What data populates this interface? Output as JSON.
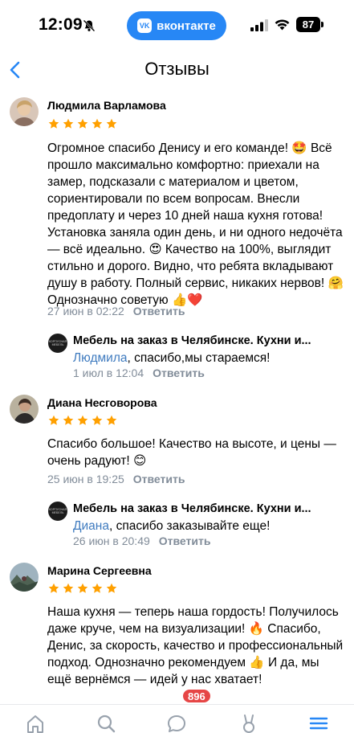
{
  "status_bar": {
    "time": "12:09",
    "app_name": "вконтакте",
    "battery": "87",
    "accent_color": "#2787f5"
  },
  "header": {
    "title": "Отзывы"
  },
  "reviews": [
    {
      "author": "Людмила Варламова",
      "rating": 5,
      "text": "Огромное спасибо Денису и его команде! 🤩 Всё прошло максимально комфортно: приехали на замер, подсказали с материалом и цветом, сориентировали по всем вопросам. Внесли предоплату и через 10 дней наша кухня готова! Установка заняла один день, и ни одного недочёта — всё идеально. 😍 Качество на 100%, выглядит стильно и дорого. Видно, что ребята вкладывают душу в работу. Полный сервис, никаких нервов! 🤗 Однозначно советую 👍❤️",
      "date": "27 июн в 02:22",
      "reply_label": "Ответить",
      "response": {
        "org_name": "Мебель на заказ в Челябинске. Кухни и...",
        "mention": "Людмила",
        "text": ", спасибо,мы стараемся!",
        "date": "1 июл в 12:04",
        "reply_label": "Ответить"
      }
    },
    {
      "author": "Диана Несговорова",
      "rating": 5,
      "text": "Спасибо большое! Качество на высоте, и цены — очень радуют! 😊",
      "date": "25 июн в 19:25",
      "reply_label": "Ответить",
      "response": {
        "org_name": "Мебель на заказ в Челябинске. Кухни и...",
        "mention": "Диана",
        "text": ", спасибо заказывайте еще!",
        "date": "26 июн в 20:49",
        "reply_label": "Ответить"
      }
    },
    {
      "author": "Марина Сергеевна",
      "rating": 5,
      "text": "Наша кухня — теперь наша гордость! Получилось даже круче, чем на визуализации! 🔥 Спасибо, Денис, за скорость, качество и профессиональный подход. Однозначно рекомендуем 👍 И да, мы ещё вернёмся — идей у нас хватает!"
    }
  ],
  "org_avatar_text": "КОРПУСНАЯ МЕБЕЛЬ",
  "tabbar": {
    "messages_badge": "896",
    "items": [
      "home-icon",
      "search-icon",
      "messages-icon",
      "services-icon",
      "menu-icon"
    ]
  },
  "colors": {
    "star": "#ffa000",
    "mention": "#3f7bbf",
    "meta": "#818c99",
    "badge": "#e64646"
  }
}
